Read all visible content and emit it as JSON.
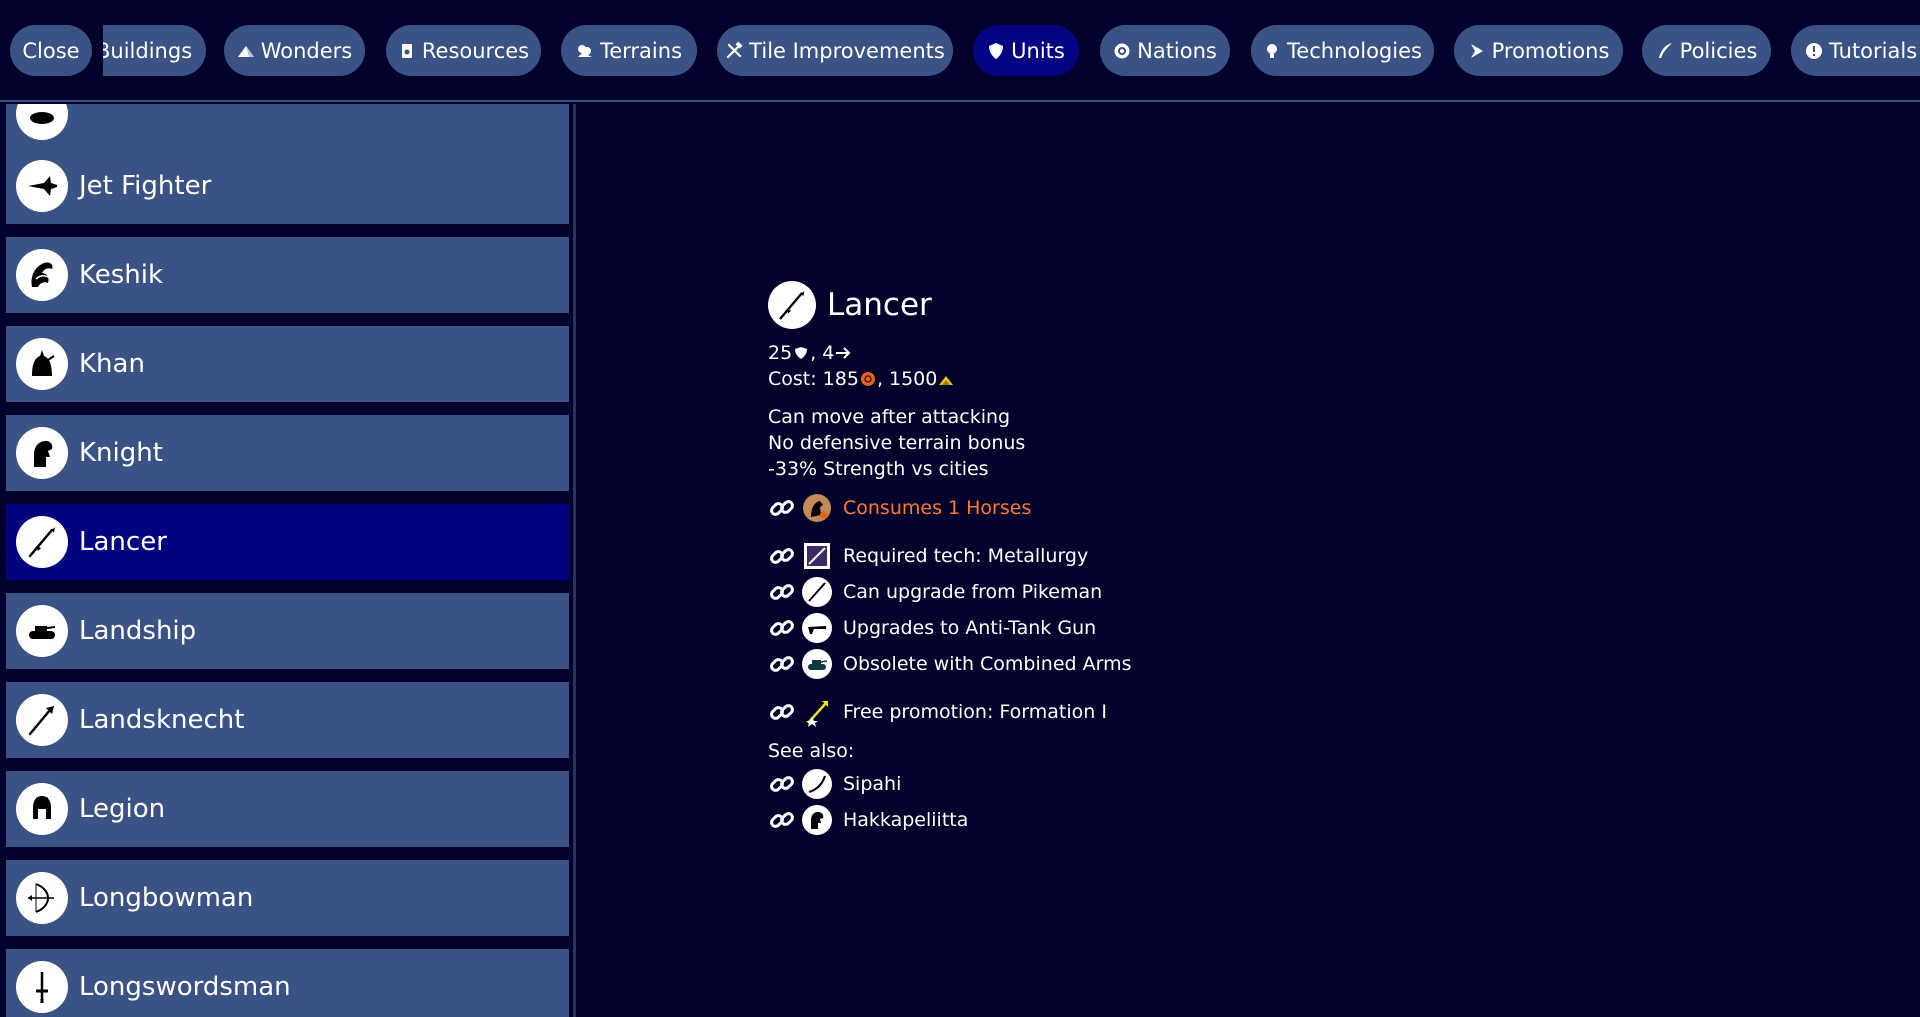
{
  "nav": {
    "close": "Close",
    "buildings": "Buildings",
    "wonders": "Wonders",
    "resources": "Resources",
    "terrains": "Terrains",
    "tile_improvements": "Tile Improvements",
    "units": "Units",
    "nations": "Nations",
    "technologies": "Technologies",
    "promotions": "Promotions",
    "policies": "Policies",
    "tutorials": "Tutorials"
  },
  "units_list": [
    {
      "label": "Jet Fighter",
      "icon": "jet-fighter-icon"
    },
    {
      "label": "Keshik",
      "icon": "keshik-icon"
    },
    {
      "label": "Khan",
      "icon": "khan-icon"
    },
    {
      "label": "Knight",
      "icon": "knight-icon"
    },
    {
      "label": "Lancer",
      "icon": "lancer-icon",
      "selected": true
    },
    {
      "label": "Landship",
      "icon": "landship-icon"
    },
    {
      "label": "Landsknecht",
      "icon": "landsknecht-icon"
    },
    {
      "label": "Legion",
      "icon": "legion-icon"
    },
    {
      "label": "Longbowman",
      "icon": "longbowman-icon"
    },
    {
      "label": "Longswordsman",
      "icon": "longswordsman-icon"
    }
  ],
  "detail": {
    "title": "Lancer",
    "strength": "25",
    "sep": ",",
    "movement": "4",
    "cost_label": "Cost: 185",
    "cost_gold": "1500",
    "abilities": [
      "Can move after attacking",
      "No defensive terrain bonus",
      "-33% Strength vs cities"
    ],
    "consumes": "Consumes 1 Horses",
    "required_tech": "Required tech: Metallurgy",
    "upgrade_from": "Can upgrade from Pikeman",
    "upgrades_to": "Upgrades to Anti-Tank Gun",
    "obsolete_with": "Obsolete with Combined Arms",
    "free_promotion": "Free promotion: Formation I",
    "see_also_label": "See also:",
    "see_also": [
      "Sipahi",
      "Hakkapeliitta"
    ]
  },
  "colors": {
    "background": "#01012c",
    "button": "#3a5384",
    "active": "#040482",
    "consumes": "#ff7a2e"
  }
}
